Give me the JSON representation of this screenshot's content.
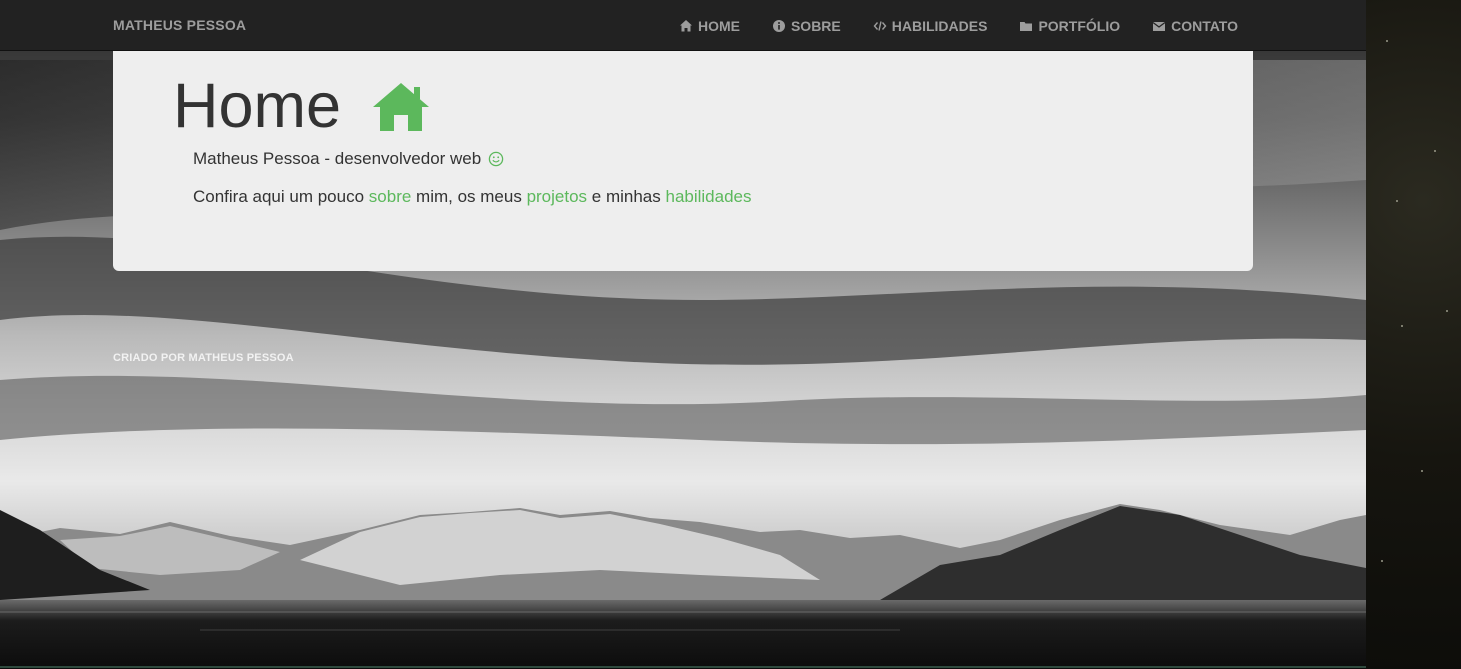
{
  "navbar": {
    "brand": "MATHEUS PESSOA",
    "items": [
      {
        "label": "HOME",
        "icon": "home-icon"
      },
      {
        "label": "SOBRE",
        "icon": "info-icon"
      },
      {
        "label": "HABILIDADES",
        "icon": "code-icon"
      },
      {
        "label": "PORTFÓLIO",
        "icon": "folder-icon"
      },
      {
        "label": "CONTATO",
        "icon": "envelope-icon"
      }
    ]
  },
  "jumbotron": {
    "title": "Home",
    "title_icon": "home-icon",
    "subtitle": "Matheus Pessoa - desenvolvedor web",
    "subtitle_icon": "smile-icon",
    "lead_part1": "Confira aqui um pouco ",
    "link_sobre": "sobre",
    "lead_part2": " mim, os meus ",
    "link_projetos": "projetos",
    "lead_part3": " e minhas ",
    "link_habilidades": "habilidades"
  },
  "footer": {
    "text": "CRIADO POR MATHEUS PESSOA"
  },
  "colors": {
    "accent": "#5cb85c",
    "navbar_bg": "#222222",
    "nav_text": "#9d9d9d",
    "jumbotron_bg": "#eeeeee"
  }
}
